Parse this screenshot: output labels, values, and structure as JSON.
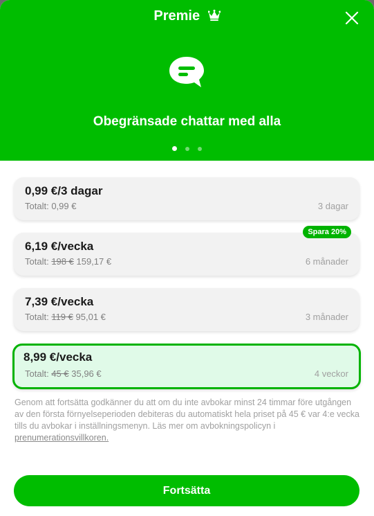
{
  "header": {
    "title": "Premie",
    "feature_text": "Obegränsade chattar med alla",
    "carousel": {
      "count": 3,
      "active_index": 0
    }
  },
  "plans": [
    {
      "price": "0,99 €/3 dagar",
      "total_label": "Totalt:",
      "old_total": "",
      "total": "0,99 €",
      "duration": "3 dagar",
      "badge": ""
    },
    {
      "price": "6,19 €/vecka",
      "total_label": "Totalt:",
      "old_total": "198 €",
      "total": "159,17 €",
      "duration": "6 månader",
      "badge": "Spara 20%"
    },
    {
      "price": "7,39 €/vecka",
      "total_label": "Totalt:",
      "old_total": "119 €",
      "total": "95,01 €",
      "duration": "3 månader",
      "badge": ""
    },
    {
      "price": "8,99 €/vecka",
      "total_label": "Totalt:",
      "old_total": "45 €",
      "total": "35,96 €",
      "duration": "4 veckor",
      "badge": "",
      "selected": true
    }
  ],
  "legal": {
    "text": "Genom att fortsätta godkänner du att om du inte avbokar minst 24 timmar före utgången av den första förnyelseperioden debiteras du automatiskt hela priset på 45 € var 4:e vecka tills du avbokar i inställningsmenyn. Läs mer om avbokningspolicyn i ",
    "link": "prenumerationsvillkoren."
  },
  "continue_label": "Fortsätta",
  "colors": {
    "brand_green": "#00bd00",
    "selected_bg": "#e0fae8"
  }
}
